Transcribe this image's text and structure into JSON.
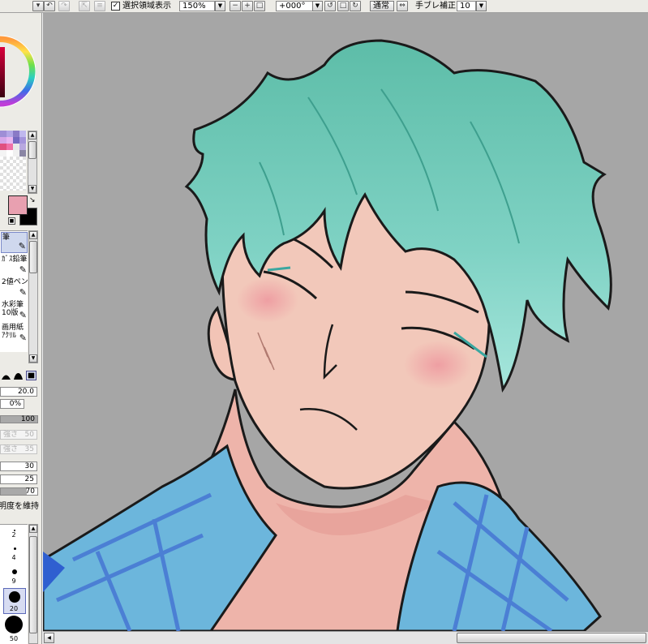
{
  "toolbar": {
    "selection_display_label": "選択領域表示",
    "selection_display_checked": "✓",
    "zoom_value": "150%",
    "rotation_value": "+000°",
    "mode_label": "通常",
    "stabilizer_label": "手ブレ補正",
    "stabilizer_value": "10"
  },
  "colors": {
    "foreground": "#e8a0b0",
    "background": "#000000",
    "canvas_bg": "#a6a6a6",
    "hair": "#6fc4b0",
    "skin": "#f2c6b8",
    "shirt": "#6ab4dc",
    "selected_tool_bg": "#cfd8ee"
  },
  "tools": [
    {
      "name": "筆",
      "line2": "",
      "icon": "brush-icon"
    },
    {
      "name": "ｶﾞｽ鉛筆",
      "line2": "",
      "icon": "pencil-icon"
    },
    {
      "name": "2値ペン",
      "line2": "",
      "icon": "pen-icon"
    },
    {
      "name": "水彩筆",
      "line2": "10版",
      "icon": "watercolor-icon"
    },
    {
      "name": "画用紙",
      "line2": "ｱｸﾘﾙ",
      "icon": "acrylic-icon"
    }
  ],
  "brush": {
    "size_value": "20.0",
    "min_size_value": "0%",
    "density_value": "100",
    "density_fill": 1.0,
    "strength1_label": "強さ",
    "strength1_value": "50",
    "strength2_label": "強さ",
    "strength2_value": "35",
    "blend_value": "30",
    "dilution_value": "25",
    "persistence_value": "70",
    "persistence_fill": 0.7,
    "keep_opacity_label": "明度を維持"
  },
  "sizes": [
    "2",
    "4",
    "9",
    "20",
    "50"
  ]
}
